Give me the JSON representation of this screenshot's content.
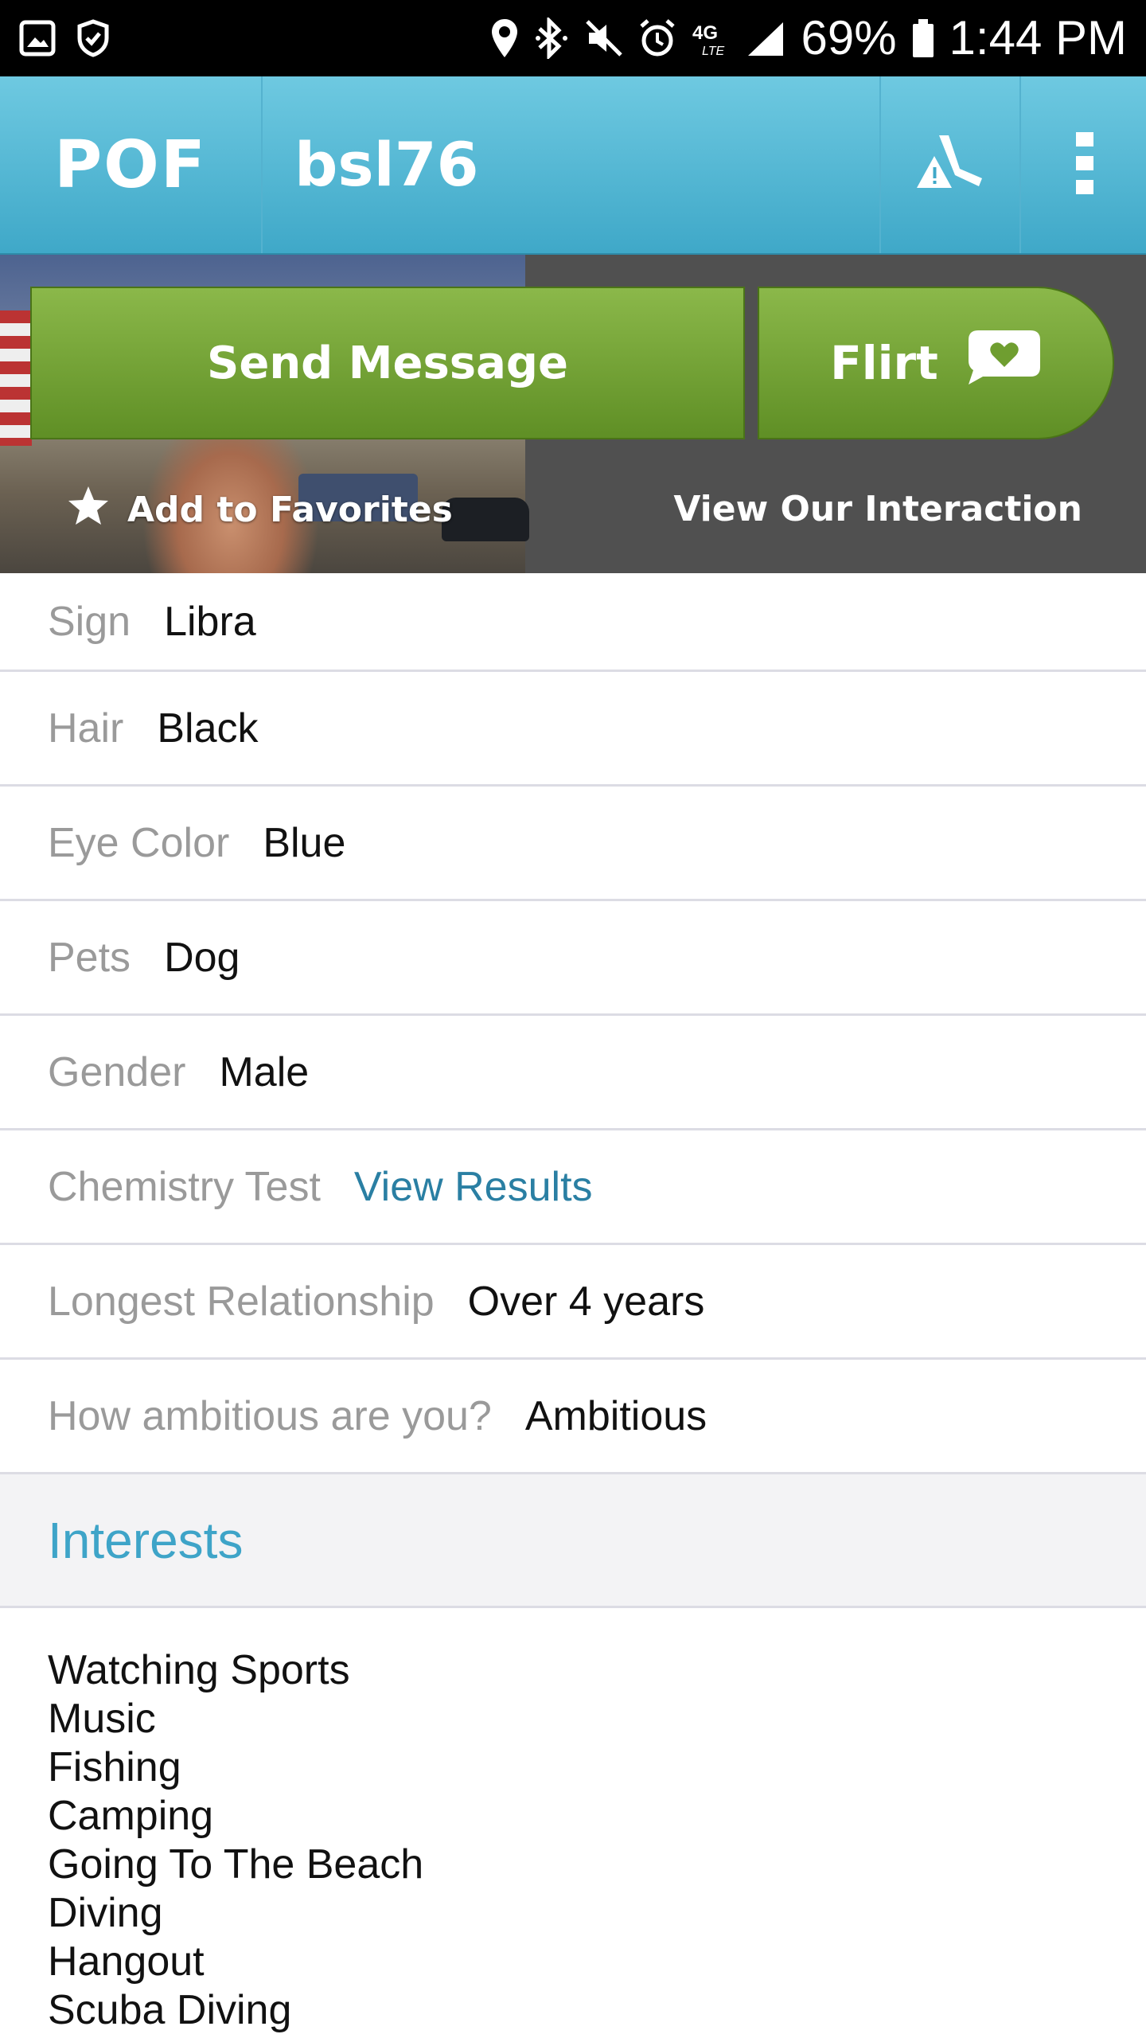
{
  "status_bar": {
    "battery": "69%",
    "time": "1:44 PM",
    "network": "4G LTE",
    "icons": [
      "gallery-icon",
      "shield-check-icon",
      "location-icon",
      "bluetooth-icon",
      "mute-icon",
      "alarm-icon",
      "network-icon",
      "signal-icon",
      "battery-icon"
    ]
  },
  "app_bar": {
    "logo": "POF",
    "username": "bsl76",
    "actions": [
      "report-icon",
      "more-icon"
    ]
  },
  "profile_header": {
    "send_message": "Send Message",
    "flirt": "Flirt",
    "add_favorites": "Add to Favorites",
    "view_interaction": "View Our Interaction"
  },
  "details": [
    {
      "label": "Sign",
      "value": "Libra"
    },
    {
      "label": "Hair",
      "value": "Black"
    },
    {
      "label": "Eye Color",
      "value": "Blue"
    },
    {
      "label": "Pets",
      "value": "Dog"
    },
    {
      "label": "Gender",
      "value": "Male"
    },
    {
      "label": "Chemistry Test",
      "value": "View Results",
      "is_link": true
    },
    {
      "label": "Longest Relationship",
      "value": "Over 4 years"
    },
    {
      "label": "How ambitious are you?",
      "value": "Ambitious"
    }
  ],
  "interests": {
    "title": "Interests",
    "items": [
      "Watching Sports",
      "Music",
      "Fishing",
      "Camping",
      "Going To The Beach",
      "Diving",
      "Hangout",
      "Scuba Diving"
    ]
  },
  "colors": {
    "app_bar": "#4fb4d3",
    "button_green": "#7aa83a",
    "link_blue": "#2a7fa3",
    "section_title": "#3ea4c8",
    "label_gray": "#9a9a9a"
  }
}
